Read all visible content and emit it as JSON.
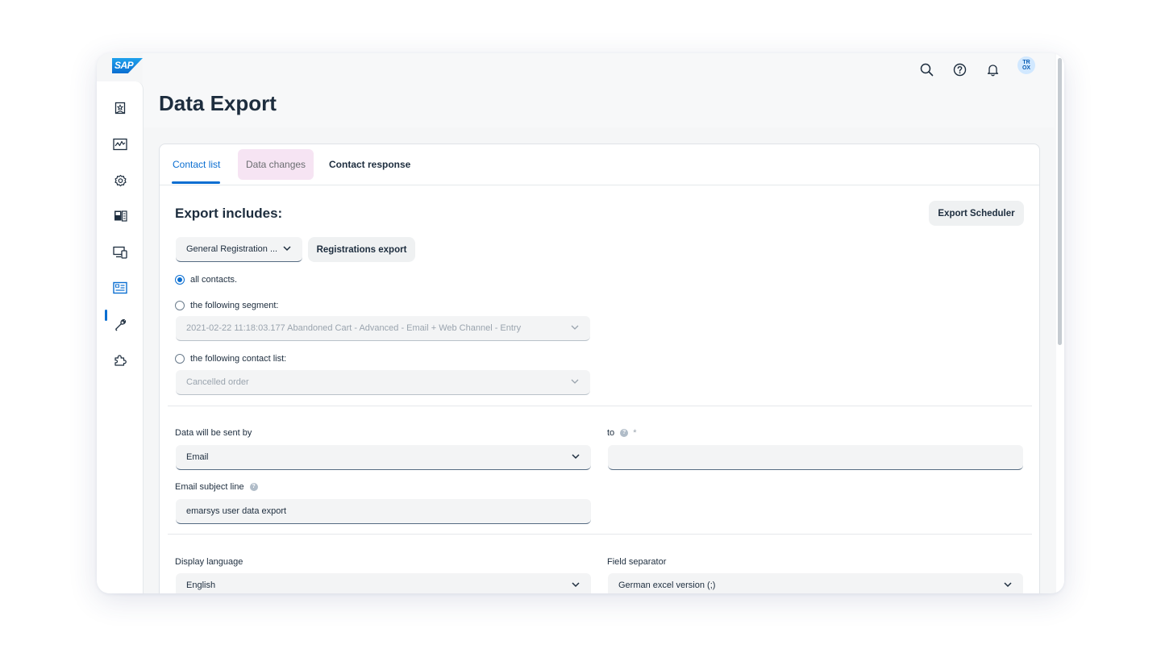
{
  "brand": {
    "logo_text": "SAP"
  },
  "topbar": {
    "icons": [
      "search-icon",
      "help-icon",
      "bell-icon"
    ],
    "avatar_initials_line1": "TR",
    "avatar_initials_line2": "OX"
  },
  "sidenav": {
    "items": [
      "bookmark-icon",
      "analytics-icon",
      "settings-icon",
      "content-icon",
      "devices-icon",
      "contact-card-icon",
      "tools-icon",
      "puzzle-icon"
    ],
    "active_index": 5
  },
  "page": {
    "title": "Data Export"
  },
  "tabs": [
    {
      "label": "Contact list",
      "active": true
    },
    {
      "label": "Data changes",
      "active": false
    },
    {
      "label": "Contact response",
      "active": false
    }
  ],
  "export_section": {
    "title": "Export includes:",
    "export_scheduler_label": "Export Scheduler",
    "registration_select_value": "General Registration ...",
    "registrations_export_label": "Registrations export",
    "radio_all_contacts": "all contacts.",
    "radio_segment": "the following segment:",
    "segment_select_value": "2021-02-22 11:18:03.177 Abandoned Cart - Advanced - Email + Web Channel - Entry",
    "radio_contact_list": "the following contact list:",
    "contact_list_select_value": "Cancelled order",
    "selected_radio": "all contacts."
  },
  "delivery_section": {
    "sent_by_label": "Data will be sent by",
    "sent_by_value": "Email",
    "to_label": "to",
    "to_required_mark": "*",
    "to_value": "",
    "subject_label": "Email subject line",
    "subject_value": "emarsys user data export"
  },
  "format_section": {
    "display_language_label": "Display language",
    "display_language_value": "English",
    "field_separator_label": "Field separator",
    "field_separator_value": "German excel version (;)"
  },
  "colors": {
    "accent": "#0a6ed1",
    "data_changes_tab_bg": "#f6e4f3",
    "avatar_bg": "#d1e8ff"
  }
}
